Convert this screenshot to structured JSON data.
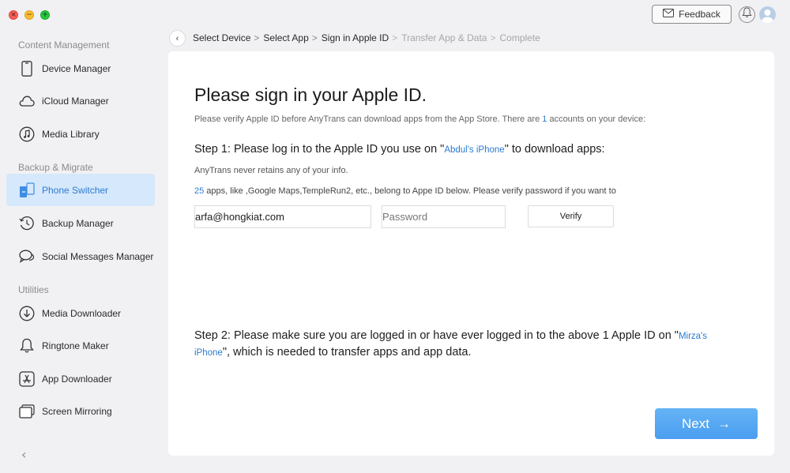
{
  "window": {
    "controls": [
      {
        "name": "close",
        "glyph": "×"
      },
      {
        "name": "minimize",
        "glyph": "−"
      },
      {
        "name": "maximize",
        "glyph": "+"
      }
    ]
  },
  "topbar": {
    "feedback_label": "Feedback",
    "icons": [
      "mail-icon",
      "bell-icon",
      "user-avatar-icon"
    ]
  },
  "sidebar": {
    "sections": [
      {
        "title": "Content Management"
      },
      {
        "title": "Backup & Migrate"
      },
      {
        "title": "Utilities"
      }
    ],
    "items": [
      {
        "label": "Device Manager",
        "icon": "phone-icon"
      },
      {
        "label": "iCloud Manager",
        "icon": "cloud-icon"
      },
      {
        "label": "Media Library",
        "icon": "music-icon"
      },
      {
        "label": "Phone Switcher",
        "icon": "phone-switch-icon",
        "active": true
      },
      {
        "label": "Backup Manager",
        "icon": "clock-back-icon"
      },
      {
        "label": "Social Messages Manager",
        "icon": "chat-icon"
      },
      {
        "label": "Media Downloader",
        "icon": "download-icon"
      },
      {
        "label": "Ringtone Maker",
        "icon": "bell-icon"
      },
      {
        "label": "App Downloader",
        "icon": "app-store-icon"
      },
      {
        "label": "Screen Mirroring",
        "icon": "screen-mirror-icon"
      }
    ],
    "collapse_glyph": "‹"
  },
  "breadcrumb": {
    "back_glyph": "‹",
    "steps": [
      {
        "label": "Select Device",
        "state": "done"
      },
      {
        "label": "Select App",
        "state": "done"
      },
      {
        "label": "Sign in Apple ID",
        "state": "current"
      },
      {
        "label": "Transfer App & Data",
        "state": "pending"
      },
      {
        "label": "Complete",
        "state": "pending"
      }
    ],
    "separator": ">"
  },
  "main": {
    "title": "Please sign in your Apple ID.",
    "subtitle": {
      "before": "Please verify Apple ID before AnyTrans can download apps from the App Store. There are ",
      "count": "1",
      "after": " accounts on your device:"
    },
    "step1": {
      "before": "Step 1: Please log in to the Apple ID you use on \"",
      "device": "Abdul's iPhone",
      "after": "\" to download apps:"
    },
    "note": "AnyTrans never retains any of your info.",
    "apps_line": {
      "count": "25",
      "text": " apps, like ,Google Maps,TempleRun2, etc., belong to Appe ID below. Please verify password if you want to"
    },
    "email_value": "arfa@hongkiat.com",
    "password_placeholder": "Password",
    "verify_label": "Verify",
    "step2": {
      "before": "Step 2: Please make sure you are logged in or have ever logged in to the above 1 Apple ID on \"",
      "device": "Mirza's iPhone",
      "after": "\", which is needed to transfer apps and app data."
    },
    "next_label": "Next",
    "next_glyph": "→"
  },
  "colors": {
    "accent": "#2d7bd0",
    "active_bg": "#d6e8fb",
    "next_button": "#4a9ef0",
    "page_bg": "#f1f1f3"
  }
}
